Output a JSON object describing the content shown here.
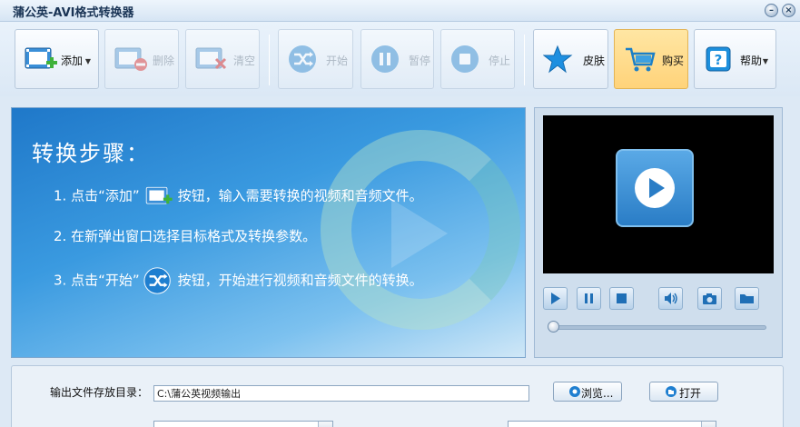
{
  "window": {
    "title": "蒲公英-AVI格式转换器"
  },
  "toolbar": {
    "add": "添加",
    "delete": "删除",
    "clear": "清空",
    "start": "开始",
    "pause": "暂停",
    "stop": "停止",
    "skin": "皮肤",
    "buy": "购买",
    "help": "帮助"
  },
  "instructions": {
    "heading": "转换步骤：",
    "step1_a": "1. 点击“添加”",
    "step1_b": "按钮，输入需要转换的视频和音频文件。",
    "step2": "2. 在新弹出窗口选择目标格式及转换参数。",
    "step3_a": "3. 点击“开始”",
    "step3_b": "按钮，开始进行视频和音频文件的转换。"
  },
  "output": {
    "dir_label": "输出文件存放目录：",
    "dir_value": "C:\\蒲公英视频输出",
    "browse": "浏览...",
    "open": "打开"
  },
  "colors": {
    "accent": "#2a7dc6",
    "buy_bg": "#ffd37a",
    "panel_bg": "#dde9f5"
  },
  "icons": [
    "minimize-icon",
    "close-icon",
    "add-video-icon",
    "delete-video-icon",
    "clear-video-icon",
    "shuffle-start-icon",
    "pause-icon",
    "stop-icon",
    "star-icon",
    "cart-icon",
    "help-icon",
    "play-icon",
    "volume-icon",
    "camera-icon",
    "folder-icon"
  ]
}
